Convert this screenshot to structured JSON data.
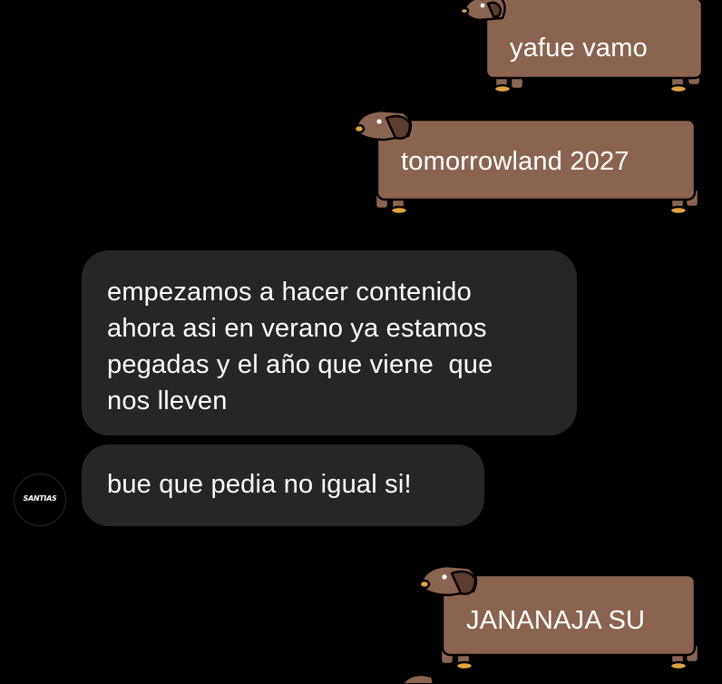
{
  "conversation": {
    "sent_messages": [
      {
        "text": "yafue vamo"
      },
      {
        "text": "tomorrowland 2027"
      },
      {
        "text": "JANANAJA SU"
      }
    ],
    "received_messages": [
      {
        "lines": [
          "empezamos a hacer contenido",
          "ahora asi en verano ya estamos",
          "pegadas y el año que viene  que",
          "nos lleven"
        ]
      },
      {
        "lines": [
          "bue que pedia no igual si!"
        ]
      }
    ],
    "avatar": {
      "label": "SANTIAS",
      "icon": "profile-avatar"
    }
  },
  "theme": {
    "background": "#000000",
    "received_bubble": "#262626",
    "sent_bubble_dog_body": "#8b6451",
    "dog_ear": "#5a3d2e",
    "dog_nose_and_paws": "#e0a33f",
    "text": "#ffffff"
  }
}
